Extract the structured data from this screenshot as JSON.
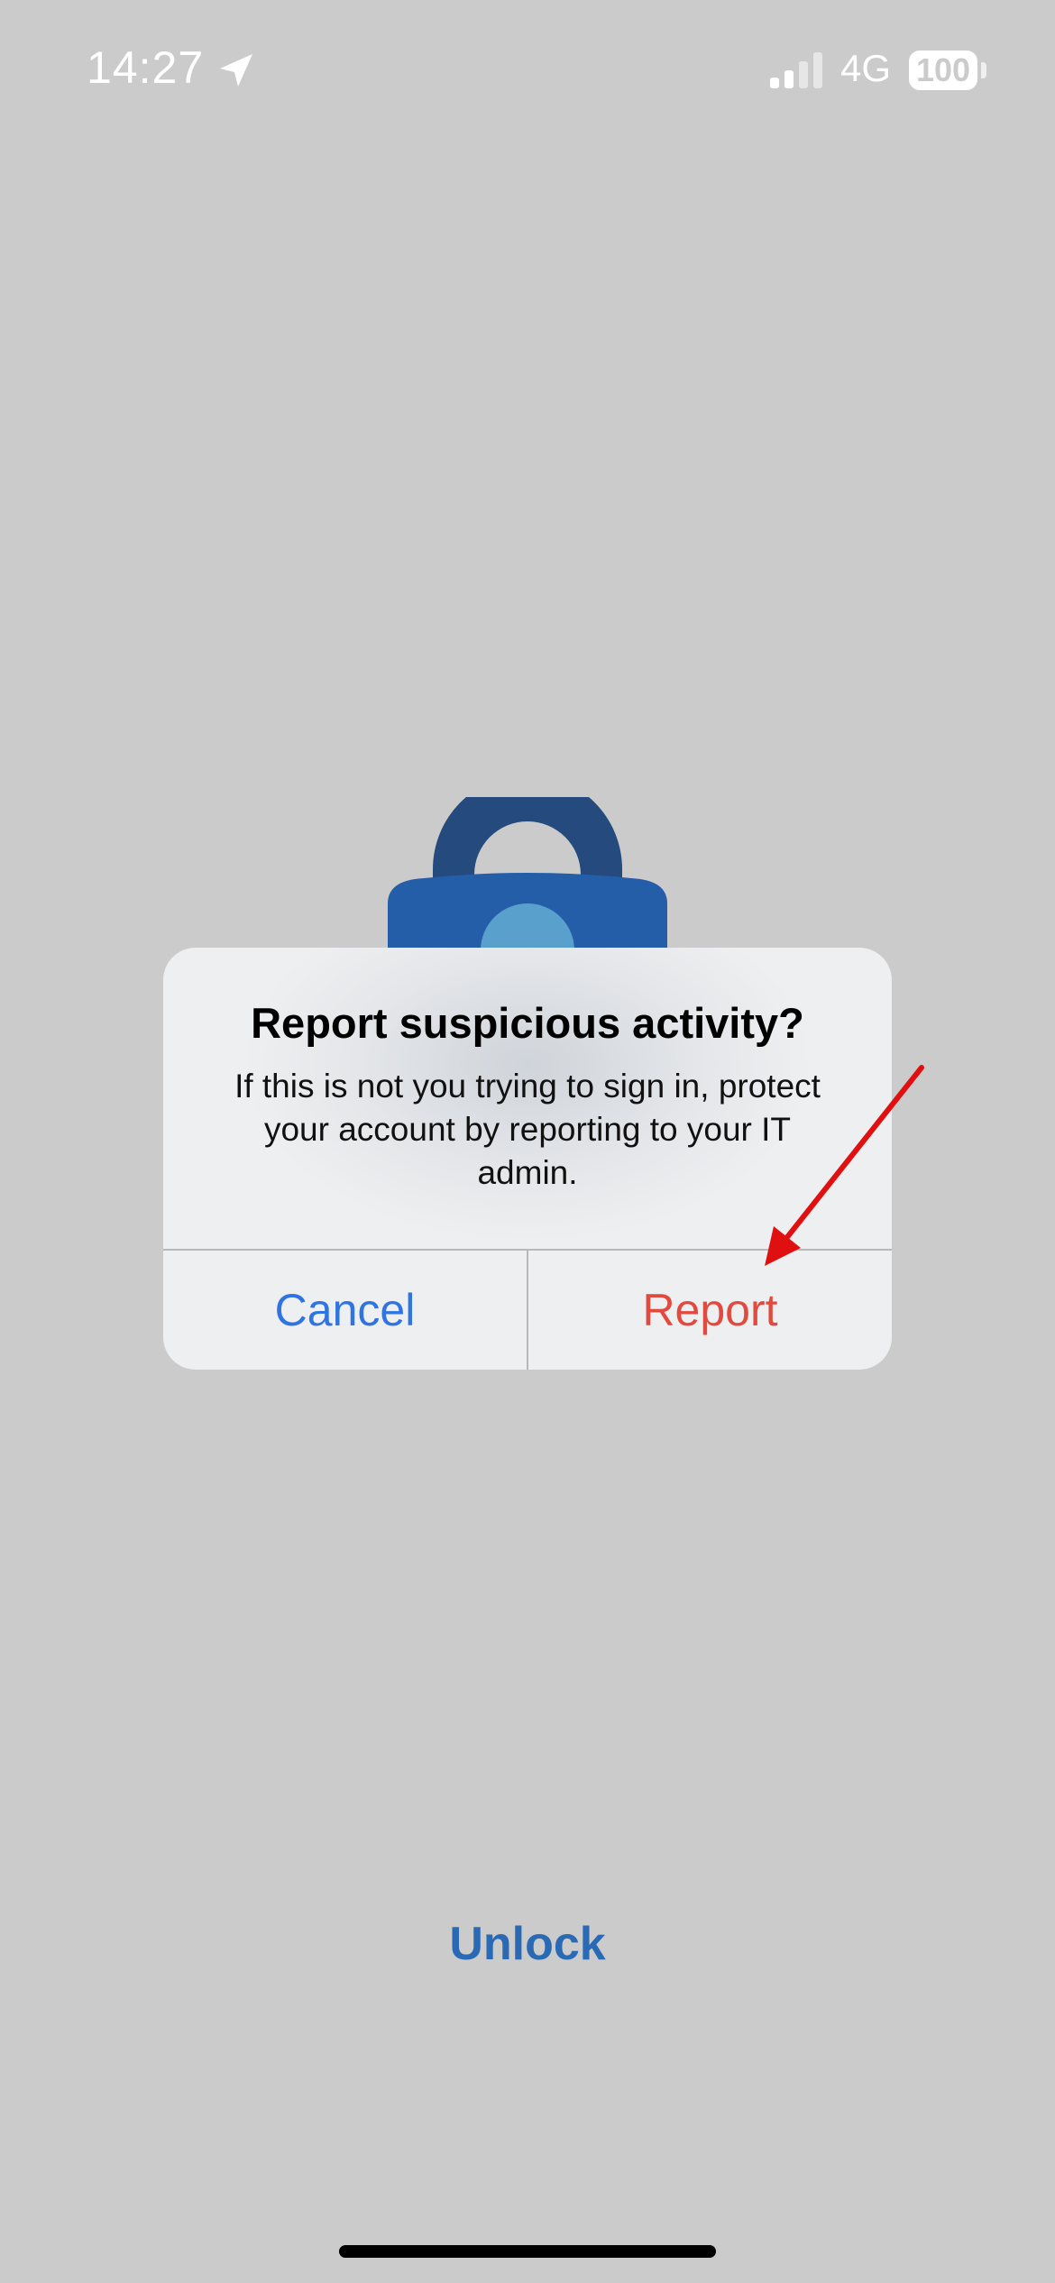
{
  "status_bar": {
    "time": "14:27",
    "network": "4G",
    "battery": "100",
    "icons": [
      "location-arrow-icon",
      "cellular-signal-icon",
      "battery-icon"
    ]
  },
  "background_art": {
    "icon": "padlock-icon",
    "colors": {
      "shackle": "#244a7e",
      "body": "#245ea8",
      "keyhole": "#5aa0cc"
    }
  },
  "dialog": {
    "title": "Report suspicious activity?",
    "message": "If this is not you trying to sign in, protect your account by reporting to your IT admin.",
    "cancel_label": "Cancel",
    "report_label": "Report"
  },
  "annotation": {
    "icon": "red-arrow-icon",
    "color": "#e01010"
  },
  "unlock_label": "Unlock",
  "colors": {
    "background": "#cbcbcb",
    "cancel": "#2f74e0",
    "destructive": "#e14a3f",
    "unlock": "#2a6ab5"
  }
}
